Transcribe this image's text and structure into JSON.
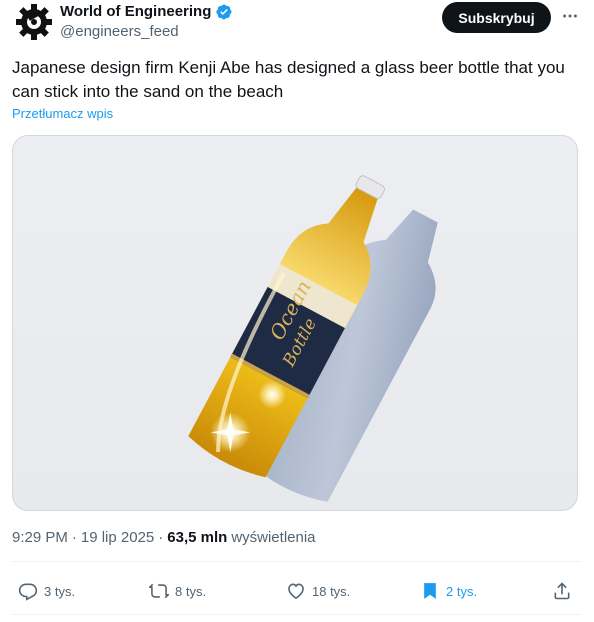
{
  "author": {
    "name": "World of Engineering",
    "handle": "@engineers_feed",
    "verified_icon": "verified-badge-icon",
    "avatar_icon": "gear-logo-icon"
  },
  "header": {
    "subscribe_label": "Subskrybuj",
    "more_icon": "more-dots-icon"
  },
  "tweet": {
    "text": "Japanese design firm Kenji Abe has designed a glass beer bottle that you can stick into the sand on the beach",
    "translate_label": "Przetłumacz wpis",
    "media_alt": "Amber glass beer bottle with navy label lying on a light background"
  },
  "meta": {
    "time": "9:29 PM",
    "separator": "·",
    "date": "19 lip 2025",
    "views_count": "63,5 mln",
    "views_label": "wyświetlenia"
  },
  "actions": {
    "replies": "3 tys.",
    "reposts": "8 tys.",
    "likes": "18 tys.",
    "bookmarks": "2 tys."
  },
  "colors": {
    "accent": "#1d9bf0",
    "text": "#0f1419",
    "secondary": "#536471"
  }
}
